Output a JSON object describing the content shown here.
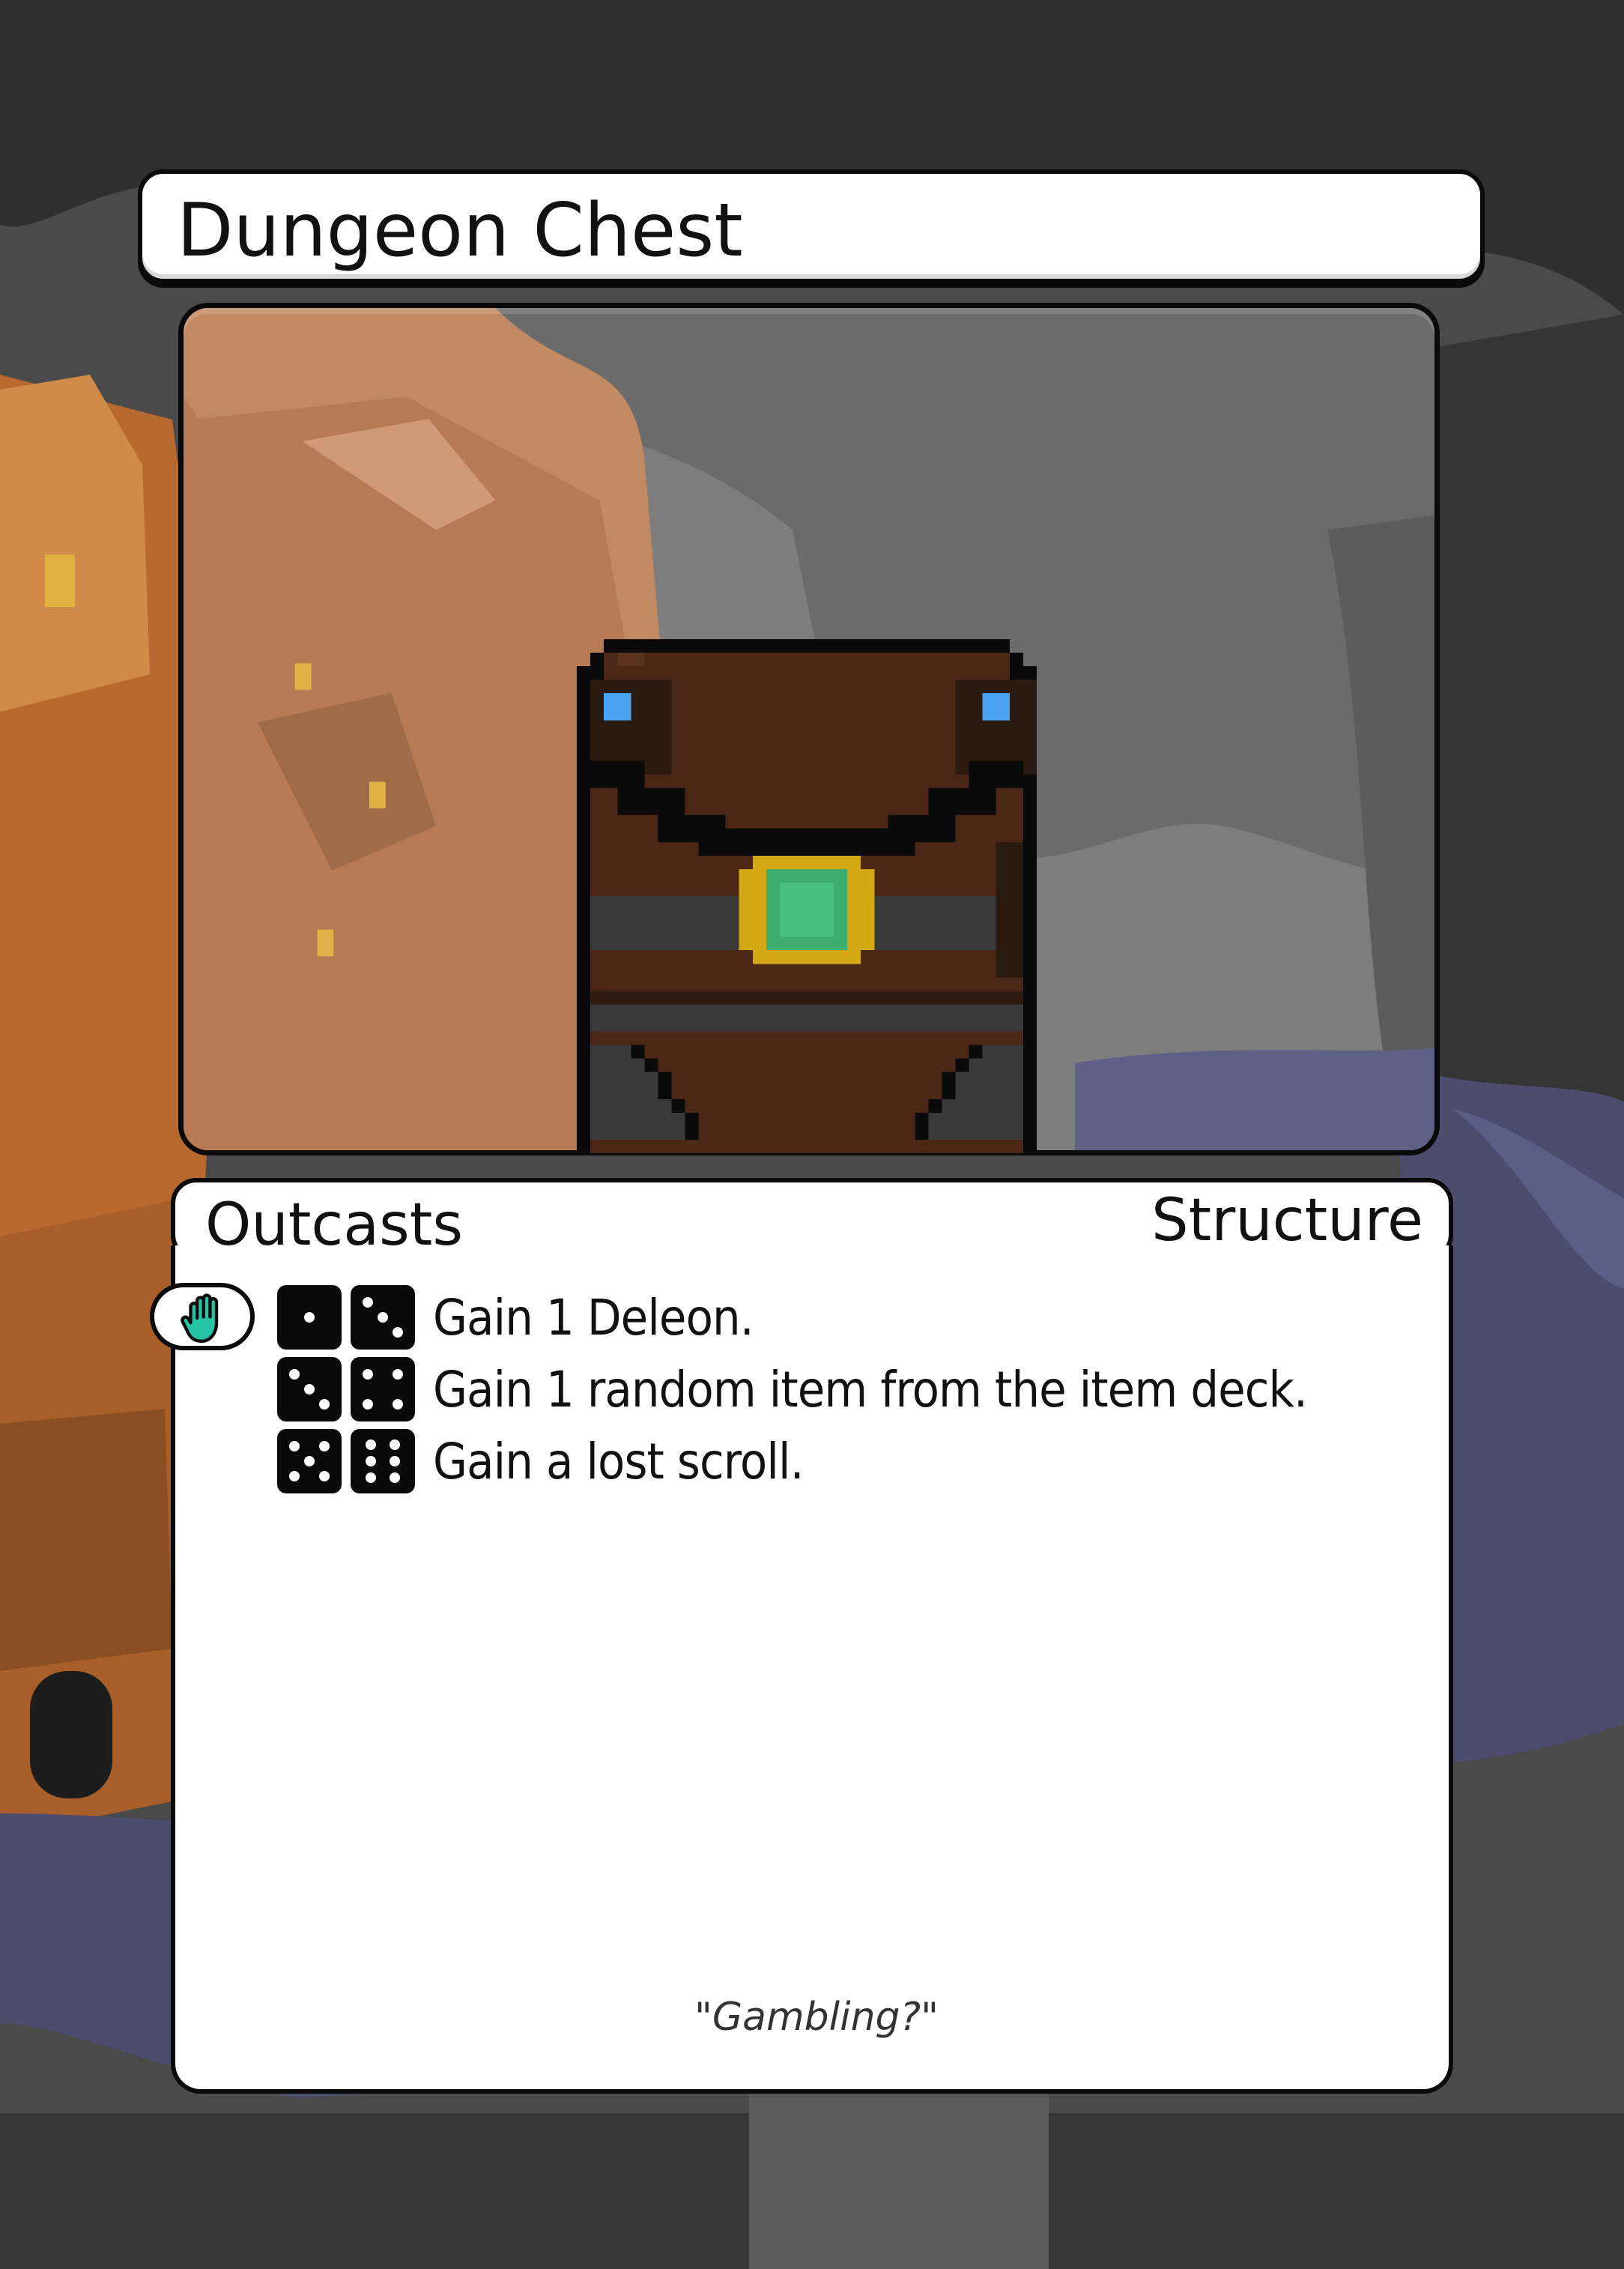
{
  "card": {
    "title": "Dungeon Chest",
    "faction": "Outcasts",
    "type": "Structure",
    "effects": [
      {
        "dice": [
          1,
          3
        ],
        "text": "Gain 1 Deleon."
      },
      {
        "dice": [
          3,
          4
        ],
        "text": "Gain 1 random item from the item deck."
      },
      {
        "dice": [
          5,
          6
        ],
        "text": "Gain a lost scroll."
      }
    ],
    "flavor": "\"Gambling?\""
  },
  "icons": {
    "activation": "hand-icon",
    "art": "treasure-chest-icon",
    "dice": "die-face-icon"
  },
  "colors": {
    "chest_wood": "#4a2716",
    "chest_band": "#3a3a3a",
    "gem": "#3dae6e",
    "gem_setting": "#d4a814",
    "latch": "#4aa3f0",
    "hand": "#27c3a6",
    "town": "#c97a3e",
    "water": "#4a4d6e",
    "cave": "#555555"
  }
}
